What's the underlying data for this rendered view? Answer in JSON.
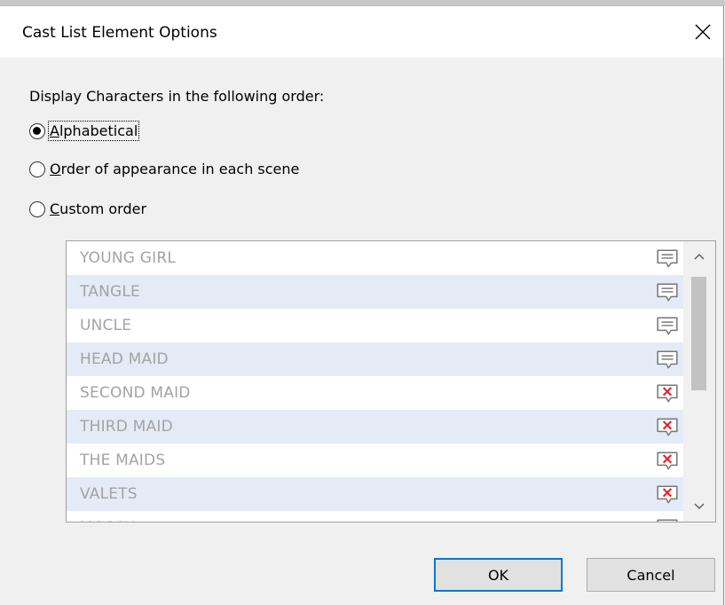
{
  "dialog": {
    "title": "Cast List Element Options",
    "close_icon": "close-icon"
  },
  "prompt": "Display Characters in the following order:",
  "order_options": {
    "selected": "Alphabetical",
    "items": [
      {
        "label_first": "A",
        "label_rest": "lphabetical",
        "checked": true
      },
      {
        "label_first": "O",
        "label_rest": "rder of appearance in each scene",
        "checked": false
      },
      {
        "label_first": "C",
        "label_rest": "ustom order",
        "checked": false
      }
    ]
  },
  "cast_list": {
    "rows": [
      {
        "name": "YOUNG GIRL",
        "icon": "speech-bubble-icon"
      },
      {
        "name": "TANGLE",
        "icon": "speech-bubble-icon"
      },
      {
        "name": "UNCLE",
        "icon": "speech-bubble-icon"
      },
      {
        "name": "HEAD MAID",
        "icon": "speech-bubble-icon"
      },
      {
        "name": "SECOND MAID",
        "icon": "speech-bubble-x-icon"
      },
      {
        "name": "THIRD MAID",
        "icon": "speech-bubble-x-icon"
      },
      {
        "name": "THE MAIDS",
        "icon": "speech-bubble-x-icon"
      },
      {
        "name": "VALETS",
        "icon": "speech-bubble-x-icon"
      },
      {
        "name": "MOSSY",
        "icon": "speech-bubble-icon"
      }
    ]
  },
  "buttons": {
    "ok": "OK",
    "cancel": "Cancel"
  },
  "colors": {
    "accent": "#0078d7",
    "alt_row": "#e4ebf6",
    "disabled_text": "#a3a3a3",
    "x_mark": "#e0262a"
  }
}
